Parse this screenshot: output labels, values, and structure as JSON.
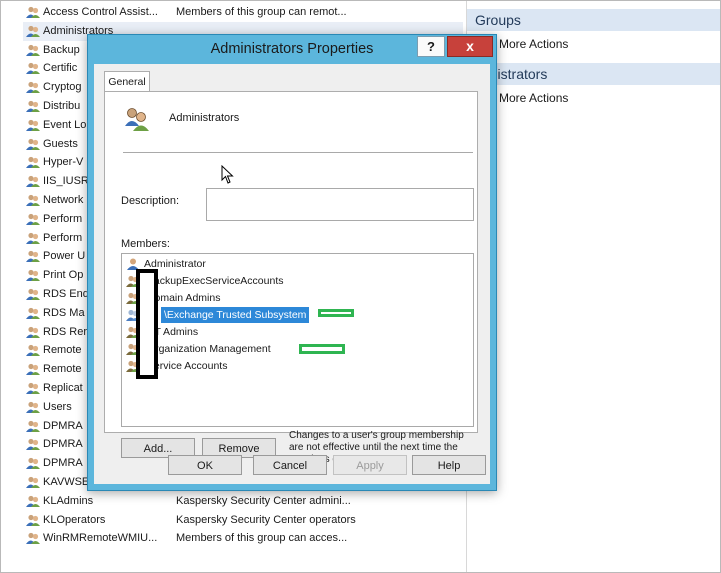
{
  "background_list": {
    "rows": [
      {
        "name": "Access Control Assist...",
        "desc": "Members of this group can remot...",
        "selected": false
      },
      {
        "name": "Administrators",
        "desc": "",
        "selected": true
      },
      {
        "name": "Backup",
        "desc": "",
        "selected": false
      },
      {
        "name": "Certific",
        "desc": "",
        "selected": false
      },
      {
        "name": "Cryptog",
        "desc": "",
        "selected": false
      },
      {
        "name": "Distribu",
        "desc": "",
        "selected": false
      },
      {
        "name": "Event Lo",
        "desc": "",
        "selected": false
      },
      {
        "name": "Guests",
        "desc": "",
        "selected": false
      },
      {
        "name": "Hyper-V",
        "desc": "",
        "selected": false
      },
      {
        "name": "IIS_IUSR",
        "desc": "",
        "selected": false
      },
      {
        "name": "Network",
        "desc": "",
        "selected": false
      },
      {
        "name": "Perform",
        "desc": "",
        "selected": false
      },
      {
        "name": "Perform",
        "desc": "",
        "selected": false
      },
      {
        "name": "Power U",
        "desc": "",
        "selected": false
      },
      {
        "name": "Print Op",
        "desc": "",
        "selected": false
      },
      {
        "name": "RDS End",
        "desc": "",
        "selected": false
      },
      {
        "name": "RDS Ma",
        "desc": "",
        "selected": false
      },
      {
        "name": "RDS Rer",
        "desc": "",
        "selected": false
      },
      {
        "name": "Remote",
        "desc": "",
        "selected": false
      },
      {
        "name": "Remote",
        "desc": "",
        "selected": false
      },
      {
        "name": "Replicat",
        "desc": "",
        "selected": false
      },
      {
        "name": "Users",
        "desc": "",
        "selected": false
      },
      {
        "name": "DPMRA",
        "desc": "",
        "selected": false
      },
      {
        "name": "DPMRA",
        "desc": "",
        "selected": false
      },
      {
        "name": "DPMRA",
        "desc": "",
        "selected": false
      },
      {
        "name": "KAVWSE",
        "desc": "",
        "selected": false
      },
      {
        "name": "KLAdmins",
        "desc": "Kaspersky Security Center admini...",
        "selected": false
      },
      {
        "name": "KLOperators",
        "desc": "Kaspersky Security Center operators",
        "selected": false
      },
      {
        "name": "WinRMRemoteWMIU...",
        "desc": "Members of this group can acces...",
        "selected": false
      }
    ]
  },
  "actions_pane": {
    "sections": [
      {
        "header": "Groups",
        "item": "More Actions"
      },
      {
        "header": "ministrators",
        "item": "More Actions"
      }
    ]
  },
  "dialog": {
    "title": "Administrators Properties",
    "help_label": "?",
    "close_label": "x",
    "tab_general": "General",
    "group_name": "Administrators",
    "description_label": "Description:",
    "description_value": "",
    "members_label": "Members:",
    "members": [
      {
        "text": "Administrator",
        "selected": false
      },
      {
        "text": "\\BackupExecServiceAccounts",
        "selected": false
      },
      {
        "text": "\\Domain Admins",
        "selected": false
      },
      {
        "text": "\\Exchange Trusted Subsystem",
        "selected": true
      },
      {
        "text": "\\NT Admins",
        "selected": false
      },
      {
        "text": "\\Organization Management",
        "selected": false
      },
      {
        "text": "\\Service Accounts",
        "selected": false
      }
    ],
    "add_label": "Add...",
    "remove_label": "Remove",
    "note": "Changes to a user's group membership are not effective until the next time the user logs on.",
    "ok_label": "OK",
    "cancel_label": "Cancel",
    "apply_label": "Apply",
    "help_button_label": "Help"
  },
  "colors": {
    "title_bar": "#5cb6dc",
    "close_button": "#c7413b",
    "selection": "#2d88d8",
    "annotation_green": "#2fb551"
  }
}
